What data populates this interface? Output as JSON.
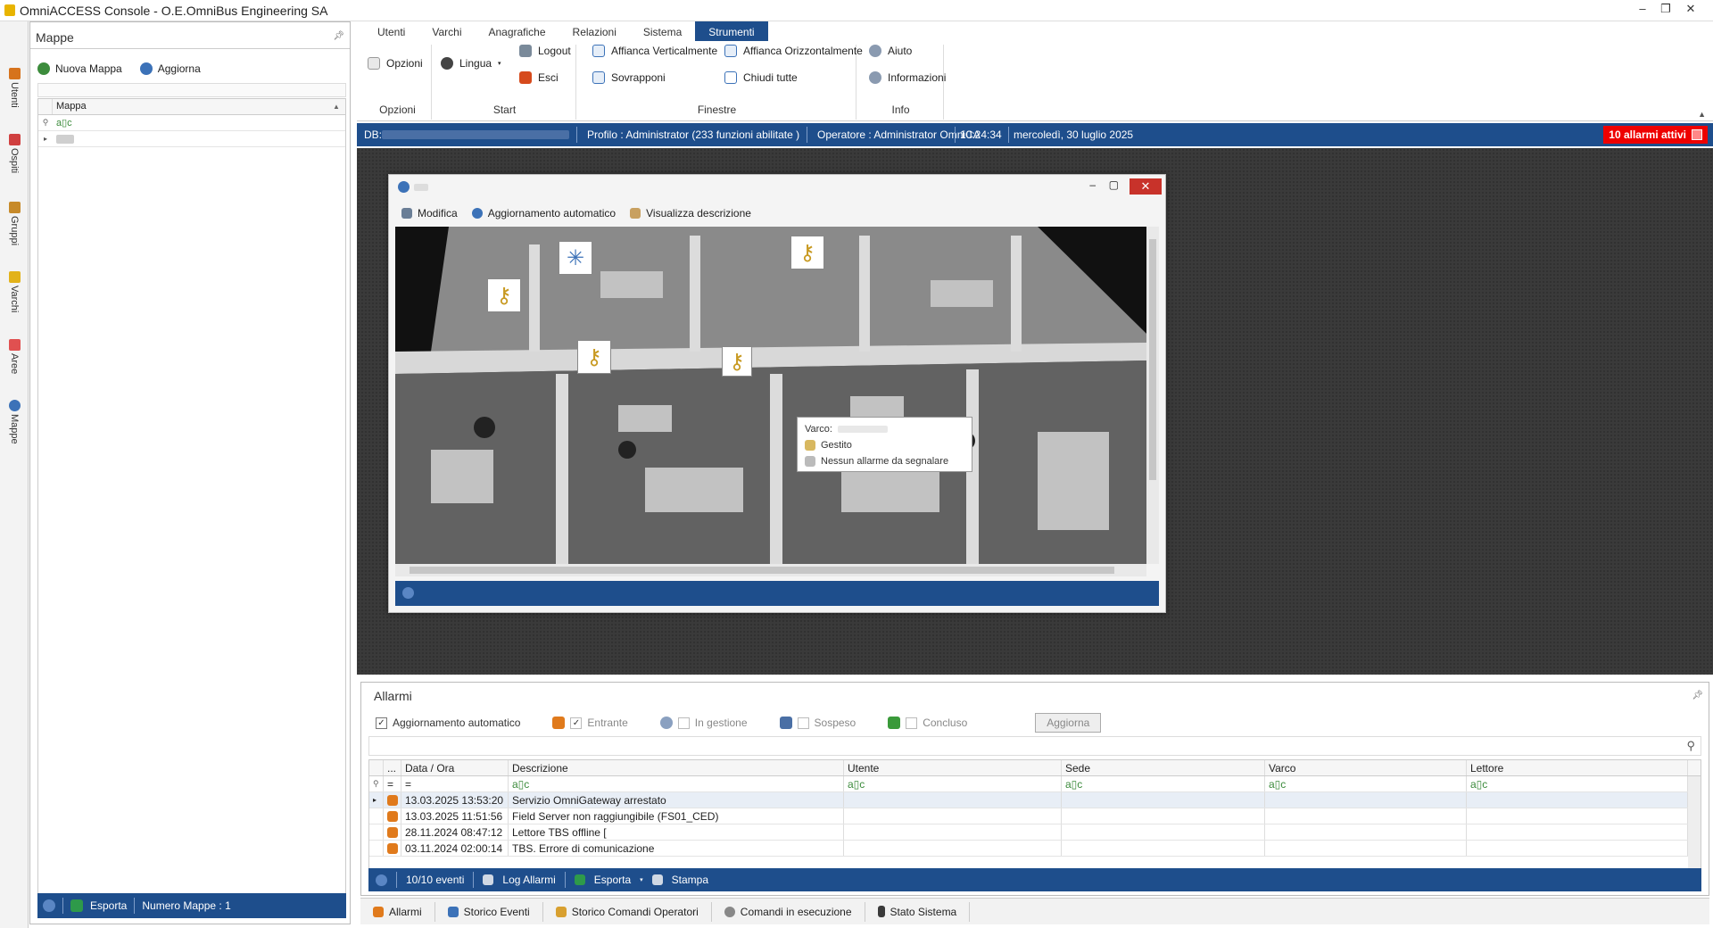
{
  "window": {
    "title": "OmniACCESS Console - O.E.OmniBus Engineering SA"
  },
  "rail": {
    "items": [
      "Utenti",
      "Ospiti",
      "Gruppi",
      "Varchi",
      "Aree",
      "Mappe"
    ]
  },
  "mappe_panel": {
    "title": "Mappe",
    "toolbar": {
      "new_map": "Nuova Mappa",
      "refresh": "Aggiorna"
    },
    "grid": {
      "column": "Mappa",
      "filter_symbol": "a▯c"
    },
    "footer": {
      "export": "Esporta",
      "count": "Numero Mappe : 1"
    }
  },
  "ribbon": {
    "tabs": [
      "Utenti",
      "Varchi",
      "Anagrafiche",
      "Relazioni",
      "Sistema",
      "Strumenti"
    ],
    "active_tab": "Strumenti",
    "groups": {
      "opzioni": {
        "label": "Opzioni",
        "btn": "Opzioni"
      },
      "start": {
        "label": "Start",
        "lingua": "Lingua",
        "logout": "Logout",
        "esci": "Esci"
      },
      "finestre": {
        "label": "Finestre",
        "affianca_v": "Affianca Verticalmente",
        "sovrapponi": "Sovrapponi",
        "affianca_o": "Affianca Orizzontalmente",
        "chiudi": "Chiudi tutte"
      },
      "info": {
        "label": "Info",
        "aiuto": "Aiuto",
        "informazioni": "Informazioni"
      }
    }
  },
  "status": {
    "db": "DB:",
    "profilo": "Profilo : Administrator (233  funzioni abilitate )",
    "operatore": "Operatore : Administrator OmniCA",
    "time": "10:24:34",
    "date": "mercoledì, 30 luglio 2025",
    "alarms": "10  allarmi attivi"
  },
  "map_window": {
    "toolbar": {
      "modifica": "Modifica",
      "auto": "Aggiornamento automatico",
      "descr": "Visualizza descrizione"
    },
    "tooltip": {
      "varco": "Varco:",
      "state": "Gestito",
      "alarm": "Nessun allarme da segnalare"
    }
  },
  "alarms_panel": {
    "title": "Allarmi",
    "auto_update": "Aggiornamento automatico",
    "filters": {
      "entrante": "Entrante",
      "in_gestione": "In gestione",
      "sospeso": "Sospeso",
      "concluso": "Concluso"
    },
    "refresh": "Aggiorna",
    "columns": [
      "...",
      "Data / Ora",
      "Descrizione",
      "Utente",
      "Sede",
      "Varco",
      "Lettore"
    ],
    "filter_eq": "=",
    "rows": [
      {
        "date": "13.03.2025 13:53:20",
        "desc": "Servizio OmniGateway arrestato"
      },
      {
        "date": "13.03.2025 11:51:56",
        "desc": "Field Server non raggiungibile (FS01_CED)"
      },
      {
        "date": "28.11.2024 08:47:12",
        "desc": "Lettore TBS offline ["
      },
      {
        "date": "03.11.2024 02:00:14",
        "desc": "TBS. Errore di comunicazione"
      }
    ],
    "footer": {
      "events": "10/10  eventi",
      "log": "Log Allarmi",
      "export": "Esporta",
      "print": "Stampa"
    }
  },
  "bottom_tabs": [
    "Allarmi",
    "Storico Eventi",
    "Storico Comandi Operatori",
    "Comandi in esecuzione",
    "Stato Sistema"
  ]
}
